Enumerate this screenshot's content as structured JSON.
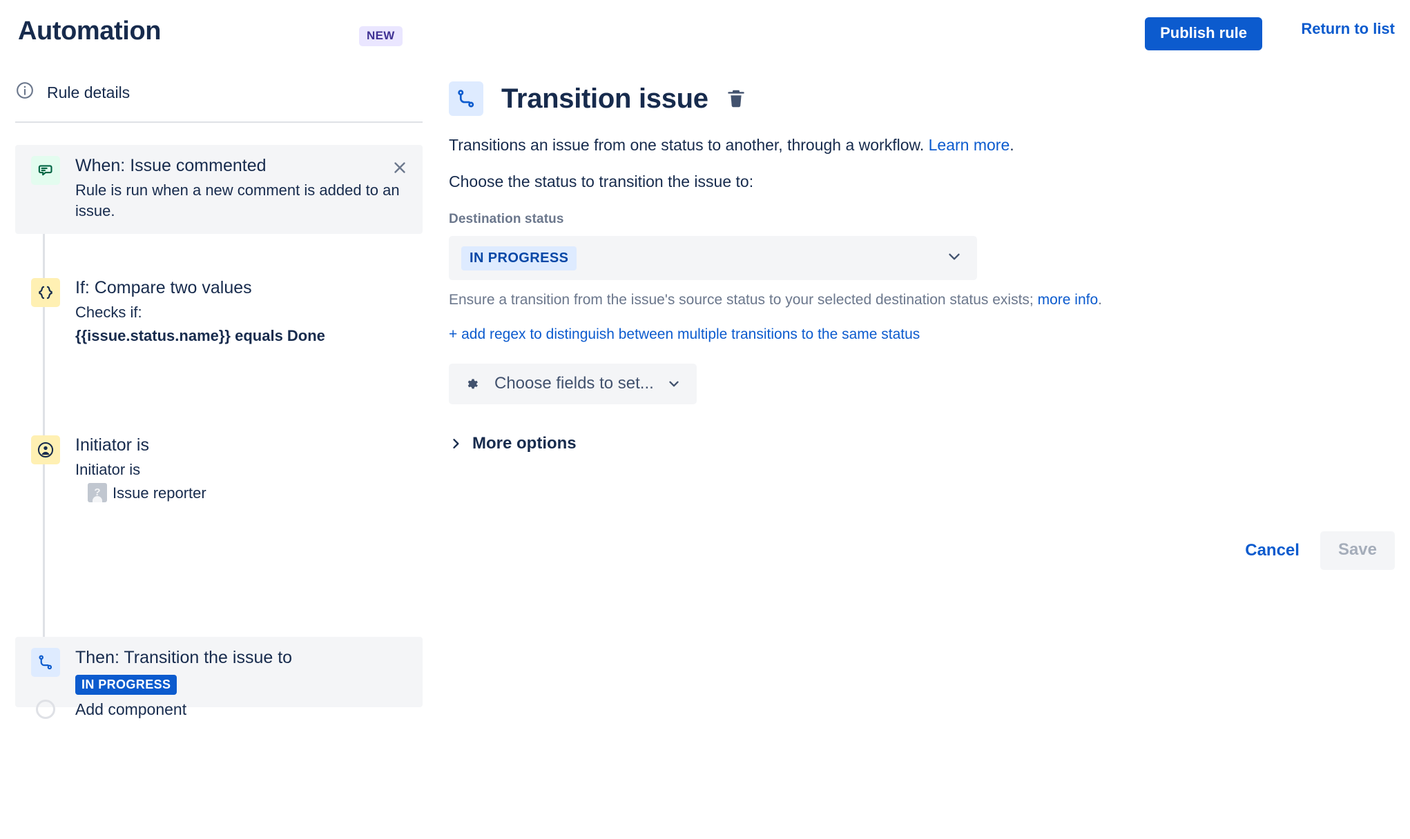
{
  "header": {
    "title": "Automation",
    "new_badge": "NEW",
    "publish_label": "Publish rule",
    "return_label": "Return to list"
  },
  "sidebar": {
    "rule_details_label": "Rule details",
    "add_component_label": "Add component",
    "nodes": [
      {
        "title": "When: Issue commented",
        "desc": "Rule is run when a new comment is added to an issue.",
        "icon": "comment-icon",
        "icon_color": "green",
        "selected": false,
        "has_close": true
      },
      {
        "title": "If: Compare two values",
        "desc": "Checks if:",
        "desc2": "{{issue.status.name}} equals Done",
        "icon": "braces-icon",
        "icon_color": "yellow",
        "selected": false,
        "has_close": false
      },
      {
        "title": "Initiator is",
        "desc": "Initiator is",
        "desc2": "Issue reporter",
        "icon": "person-icon",
        "icon_color": "yellow",
        "selected": false,
        "has_close": false
      },
      {
        "title": "Then: Transition the issue to",
        "badge": "IN PROGRESS",
        "icon": "transition-icon",
        "icon_color": "blue",
        "selected": true,
        "has_close": false
      }
    ]
  },
  "panel": {
    "heading": "Transition issue",
    "icon": "transition-icon",
    "delete_icon": "trash-icon",
    "description_text": "Transitions an issue from one status to another, through a workflow. ",
    "description_link": "Learn more",
    "description_tail": ".",
    "subheading": "Choose the status to transition the issue to:",
    "destination_label": "Destination status",
    "destination_value": "IN PROGRESS",
    "help_text": "Ensure a transition from the issue's source status to your selected destination status exists; ",
    "help_link": "more info",
    "help_tail": ".",
    "regex_link": "+ add regex to distinguish between multiple transitions to the same status",
    "fields_button": "Choose fields to set...",
    "more_options": "More options",
    "cancel_label": "Cancel",
    "save_label": "Save"
  },
  "colors": {
    "brand_blue": "#0C5BCE",
    "status_blue": "#DEEBFF",
    "trigger_green": "#E3FCEF",
    "condition_yellow": "#FFF0B3",
    "text_dark": "#172B4D",
    "text_muted": "#6B778C"
  }
}
